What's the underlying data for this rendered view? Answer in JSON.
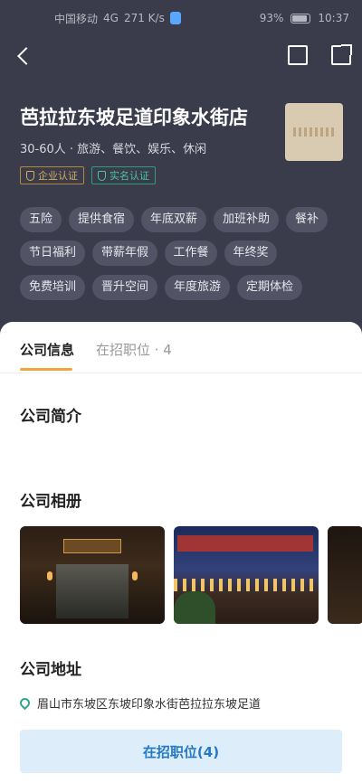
{
  "status_bar": {
    "carrier": "中国移动",
    "network": "4G",
    "speed": "271 K/s",
    "battery": "93%",
    "time": "10:37"
  },
  "company": {
    "name": "芭拉拉东坡足道印象水街店",
    "meta": "30-60人 · 旅游、餐饮、娱乐、休闲",
    "certs": [
      "企业认证",
      "实名认证"
    ]
  },
  "benefit_tags": [
    "五险",
    "提供食宿",
    "年底双薪",
    "加班补助",
    "餐补",
    "节日福利",
    "带薪年假",
    "工作餐",
    "年终奖",
    "免费培训",
    "晋升空间",
    "年度旅游",
    "定期体检"
  ],
  "tabs": {
    "info": "公司信息",
    "jobs": "在招职位 · 4"
  },
  "sections": {
    "intro": "公司简介",
    "album": "公司相册",
    "address": "公司地址"
  },
  "address_text": "眉山市东坡区东坡印象水街芭拉拉东坡足道",
  "cta_label": "在招职位(4)",
  "colors": {
    "header_bg": "#3a3b4b",
    "accent": "#f0a53a",
    "cta_text": "#2378c7",
    "cta_bg": "#ddeefa"
  }
}
